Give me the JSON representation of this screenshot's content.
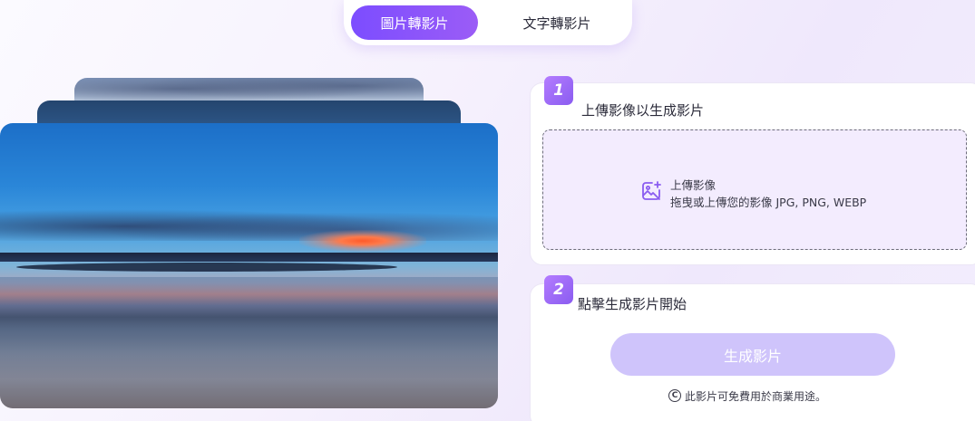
{
  "tabs": [
    {
      "label": "圖片轉影片",
      "active": true
    },
    {
      "label": "文字轉影片",
      "active": false
    }
  ],
  "colors": {
    "accent": "#8a5cf0",
    "accent_light": "#cfc4fb",
    "dropzone_bg": "#f3ecfe"
  },
  "step1": {
    "number": "1",
    "title": "上傳影像以生成影片",
    "upload_icon": "image-add-icon",
    "upload_title": "上傳影像",
    "upload_hint": "拖曳或上傳您的影像 JPG, PNG, WEBP"
  },
  "step2": {
    "number": "2",
    "title": "點擊生成影片開始",
    "button_label": "生成影片",
    "license_icon": "copyright-icon",
    "license_text": "此影片可免費用於商業用途。"
  }
}
